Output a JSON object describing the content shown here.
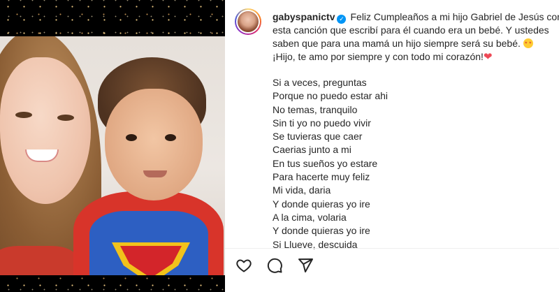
{
  "post": {
    "username": "gabyspanictv",
    "caption_lines": [
      "Feliz Cumpleaños a mi hijo Gabriel de Jesús con",
      "esta canción que escribí para él cuando era un bebé. Y ustedes",
      "saben que para una mamá un hijo siempre será su bebé.",
      "¡Hijo, te amo por siempre y con todo mi corazón!"
    ],
    "verses": [
      "Si a veces, preguntas",
      "Porque no puedo estar ahi",
      "No temas, tranquilo",
      "Sin ti yo no puedo vivir",
      "Se tuvieras que caer",
      "Caerias junto a mi",
      "En tus sueños yo estare",
      "Para hacerte muy feliz",
      "Mi vida, daria",
      "Y donde quieras yo ire",
      "A la cima, volaria",
      "Y donde quieras yo ire",
      "Si Llueve, descuida"
    ]
  },
  "icons": {
    "verified": "verified-badge-icon",
    "emoji": "star-struck-emoji-icon",
    "heart_emoji": "red-heart-icon",
    "like": "heart-outline-icon",
    "comment": "comment-icon",
    "share": "send-icon"
  },
  "colors": {
    "accent": "#0095f6",
    "heart": "#ed4956",
    "text": "#262626"
  }
}
